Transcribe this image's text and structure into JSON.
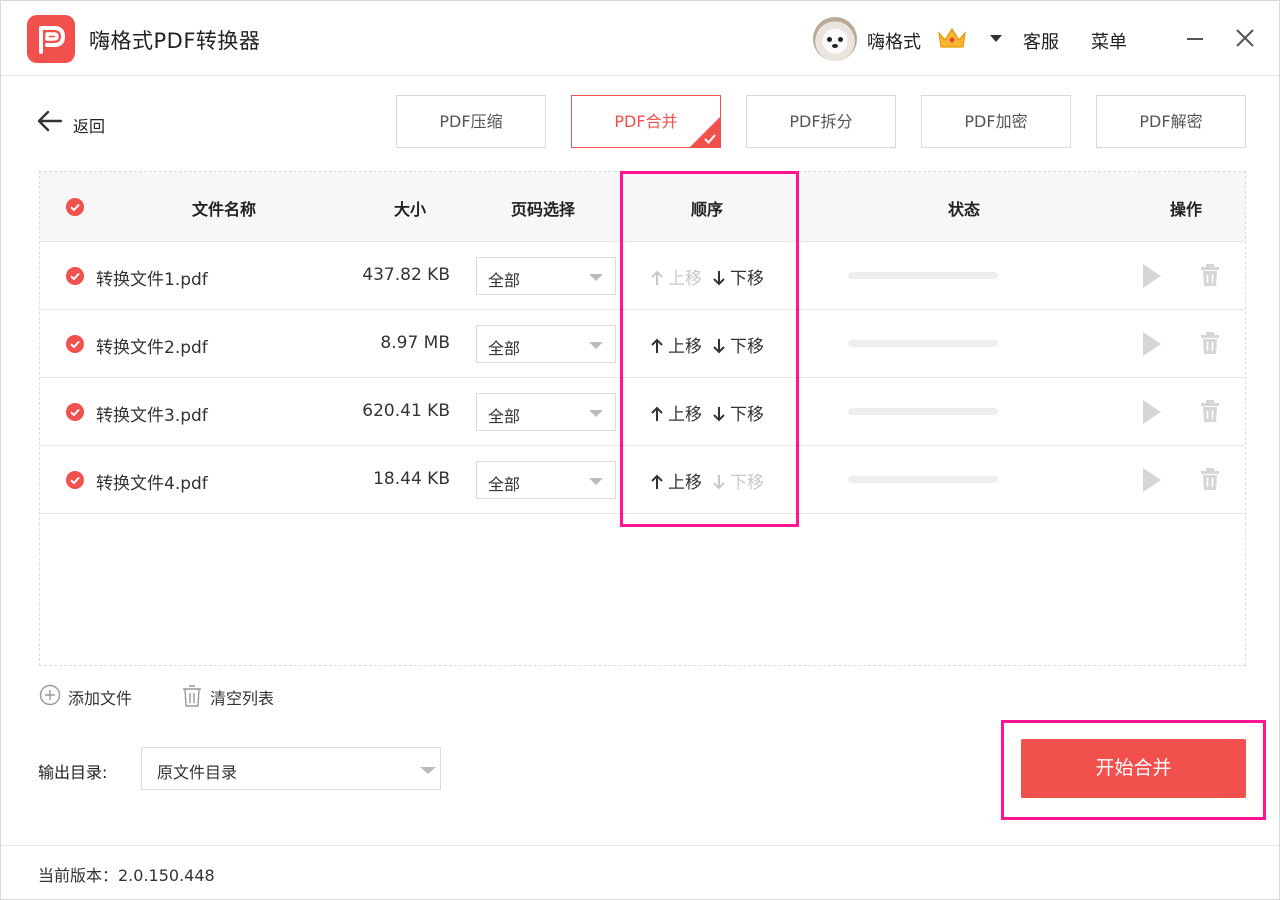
{
  "app": {
    "title": "嗨格式PDF转换器"
  },
  "user": {
    "name": "嗨格式"
  },
  "titlebar": {
    "service": "客服",
    "menu": "菜单"
  },
  "nav": {
    "back": "返回"
  },
  "tabs": [
    {
      "label": "PDF压缩",
      "active": false
    },
    {
      "label": "PDF合并",
      "active": true
    },
    {
      "label": "PDF拆分",
      "active": false
    },
    {
      "label": "PDF加密",
      "active": false
    },
    {
      "label": "PDF解密",
      "active": false
    }
  ],
  "table": {
    "headers": {
      "name": "文件名称",
      "size": "大小",
      "pages": "页码选择",
      "order": "顺序",
      "status": "状态",
      "action": "操作"
    },
    "rows": [
      {
        "name": "转换文件1.pdf",
        "size": "437.82 KB",
        "pages": "全部",
        "up": "上移",
        "down": "下移",
        "up_enabled": false,
        "down_enabled": true
      },
      {
        "name": "转换文件2.pdf",
        "size": "8.97 MB",
        "pages": "全部",
        "up": "上移",
        "down": "下移",
        "up_enabled": true,
        "down_enabled": true
      },
      {
        "name": "转换文件3.pdf",
        "size": "620.41 KB",
        "pages": "全部",
        "up": "上移",
        "down": "下移",
        "up_enabled": true,
        "down_enabled": true
      },
      {
        "name": "转换文件4.pdf",
        "size": "18.44 KB",
        "pages": "全部",
        "up": "上移",
        "down": "下移",
        "up_enabled": true,
        "down_enabled": false
      }
    ]
  },
  "actions": {
    "add": "添加文件",
    "clear": "清空列表"
  },
  "output": {
    "label": "输出目录:",
    "value": "原文件目录"
  },
  "start_button": "开始合并",
  "footer": {
    "version": "当前版本：2.0.150.448"
  },
  "colors": {
    "accent": "#f2504d",
    "highlight": "#ff1493"
  }
}
